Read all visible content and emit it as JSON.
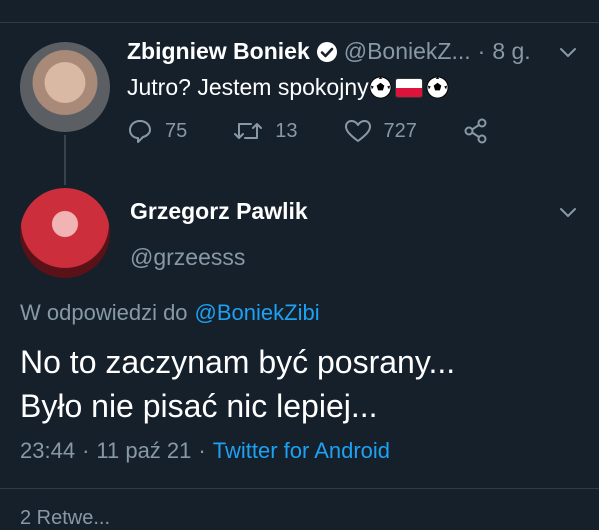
{
  "tweet1": {
    "name": "Zbigniew Boniek",
    "handle": "@BoniekZ...",
    "separator": "·",
    "time": "8 g.",
    "text": "Jutro? Jestem spokojny",
    "replies": "75",
    "retweets": "13",
    "likes": "727"
  },
  "tweet2": {
    "name": "Grzegorz Pawlik",
    "handle": "@grzeesss",
    "reply_prefix": "W odpowiedzi do",
    "reply_handle": "@BoniekZibi",
    "text_line1": "No to zaczynam być posrany...",
    "text_line2": "Było nie pisać nic lepiej...",
    "time": "23:44",
    "separator": "·",
    "date": "11 paź 21",
    "client": "Twitter for Android"
  },
  "bottom": {
    "peek_text": "2 Retwe..."
  },
  "colors": {
    "background": "#15202b",
    "muted": "#8899a6",
    "accent": "#1da1f2",
    "text": "#ffffff"
  }
}
